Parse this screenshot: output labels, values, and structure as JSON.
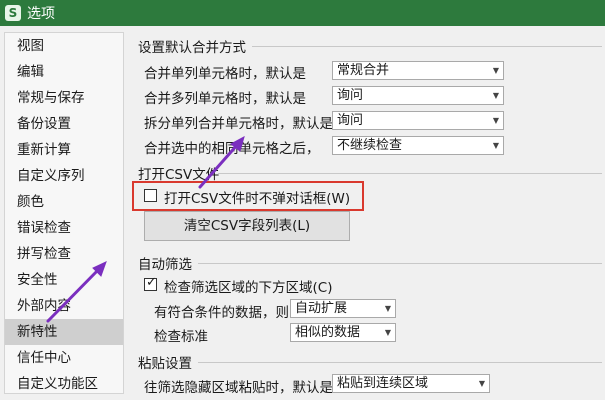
{
  "window": {
    "title": "选项",
    "app_icon_glyph": "S"
  },
  "sidebar": {
    "items": [
      {
        "label": "视图"
      },
      {
        "label": "编辑"
      },
      {
        "label": "常规与保存"
      },
      {
        "label": "备份设置"
      },
      {
        "label": "重新计算"
      },
      {
        "label": "自定义序列"
      },
      {
        "label": "颜色"
      },
      {
        "label": "错误检查"
      },
      {
        "label": "拼写检查"
      },
      {
        "label": "安全性"
      },
      {
        "label": "外部内容"
      },
      {
        "label": "新特性",
        "active": true
      },
      {
        "label": "信任中心"
      },
      {
        "label": "自定义功能区"
      }
    ]
  },
  "merge_group": {
    "title": "设置默认合并方式",
    "rows": [
      {
        "label": "合并单列单元格时，默认是",
        "value": "常规合并"
      },
      {
        "label": "合并多列单元格时，默认是",
        "value": "询问"
      },
      {
        "label": "拆分单列合并单元格时，默认是",
        "value": "询问"
      },
      {
        "label": "合并选中的相同单元格之后，",
        "value": "不继续检查"
      }
    ]
  },
  "csv_group": {
    "title": "打开CSV文件",
    "checkbox_label": "打开CSV文件时不弹对话框(W)",
    "checkbox_checked": false,
    "clear_button_label": "清空CSV字段列表(L)"
  },
  "filter_group": {
    "title": "自动筛选",
    "checkbox_label": "检查筛选区域的下方区域(C)",
    "checkbox_checked": true,
    "matching_label": "有符合条件的数据，则",
    "matching_value": "自动扩展",
    "criteria_label": "检查标准",
    "criteria_value": "相似的数据"
  },
  "paste_group": {
    "title": "粘贴设置",
    "label": "往筛选隐藏区域粘贴时，默认是",
    "value": "粘贴到连续区域"
  },
  "colors": {
    "titlebar": "#2d7a3d",
    "highlight": "#d9392e",
    "arrow": "#7b2fbf"
  }
}
